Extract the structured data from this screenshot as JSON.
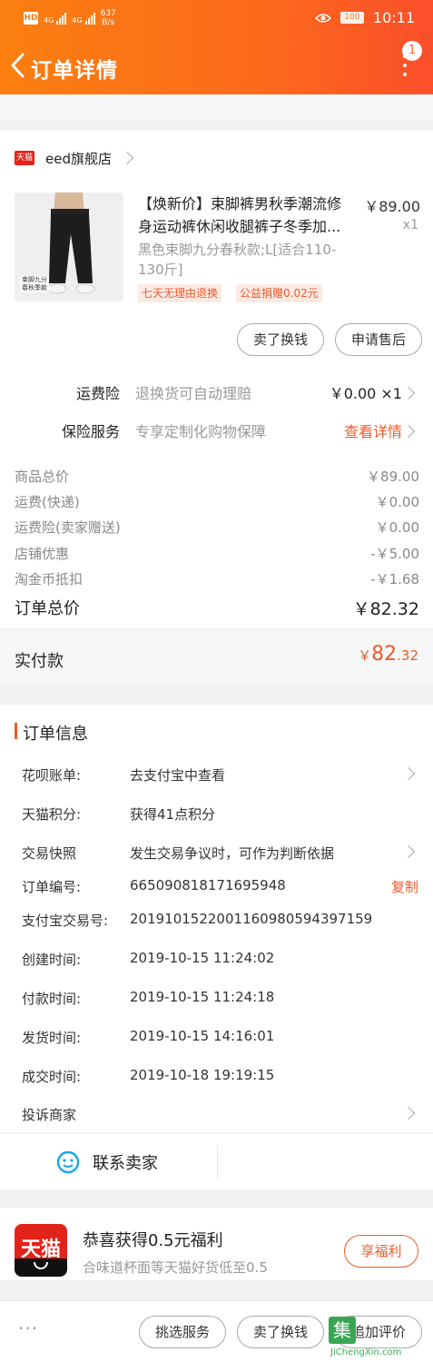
{
  "status_bar": {
    "hd": "HD",
    "signal1": "4G",
    "signal2": "4G",
    "speed_value": "637",
    "speed_unit": "B/s",
    "battery": "100",
    "time": "10:11"
  },
  "header": {
    "title": "订单详情",
    "notification_count": "1"
  },
  "store": {
    "badge": "天猫",
    "name": "eed旗舰店"
  },
  "product": {
    "title": "【焕新价】束脚裤男秋季潮流修身运动裤休闲收腿裤子冬季加...",
    "price": "￥89.00",
    "qty": "x1",
    "sku": "黑色束脚九分春秋款;L[适合110-130斤]",
    "img_caption1": "束脚九分",
    "img_caption2": "春秋季款",
    "tags": [
      "七天无理由退换",
      "公益捐赠0.02元"
    ],
    "buttons": [
      "卖了换钱",
      "申请售后"
    ]
  },
  "services": [
    {
      "label": "运费险",
      "desc": "退换货可自动理赔",
      "value": "￥0.00 ×1"
    },
    {
      "label": "保险服务",
      "desc": "专享定制化购物保障",
      "value": "查看详情"
    }
  ],
  "prices": [
    {
      "label": "商品总价",
      "value": "￥89.00"
    },
    {
      "label": "运费(快递)",
      "value": "￥0.00"
    },
    {
      "label": "运费险(卖家赠送)",
      "value": "￥0.00"
    },
    {
      "label": "店铺优惠",
      "value": "-￥5.00"
    },
    {
      "label": "淘金币抵扣",
      "value": "-￥1.68"
    }
  ],
  "order_total": {
    "label": "订单总价",
    "value": "￥82.32"
  },
  "paid": {
    "label": "实付款",
    "currency": "￥",
    "int": "82",
    "dec": ".32"
  },
  "order_info": {
    "title": "订单信息",
    "rows": [
      {
        "label": "花呗账单:",
        "value": "去支付宝中查看"
      },
      {
        "label": "天猫积分:",
        "value": "获得41点积分"
      },
      {
        "label": "交易快照",
        "value": "发生交易争议时，可作为判断依据"
      },
      {
        "label": "订单编号:",
        "value": "665090818171695948",
        "action": "复制"
      },
      {
        "label": "支付宝交易号:",
        "value": "2019101522001160980594397159"
      },
      {
        "label": "创建时间:",
        "value": "2019-10-15 11:24:02"
      },
      {
        "label": "付款时间:",
        "value": "2019-10-15 11:24:18"
      },
      {
        "label": "发货时间:",
        "value": "2019-10-15 14:16:01"
      },
      {
        "label": "成交时间:",
        "value": "2019-10-18 19:19:15"
      },
      {
        "label": "投诉商家",
        "value": ""
      }
    ],
    "contact": "联系卖家"
  },
  "promo": {
    "logo": "天猫",
    "title": "恭喜获得0.5元福利",
    "subtitle": "合味道杯面等天猫好货低至0.5",
    "button": "享福利"
  },
  "bottom_bar": {
    "more": "···",
    "buttons": [
      "挑选服务",
      "卖了换钱",
      "追加评价"
    ]
  },
  "watermark": {
    "char": "集",
    "text": "JiChengXin.com"
  },
  "colors": {
    "brand_orange": "#fb7f10",
    "accent_red": "#ec5a2a",
    "tmall_red": "#e2231a"
  }
}
